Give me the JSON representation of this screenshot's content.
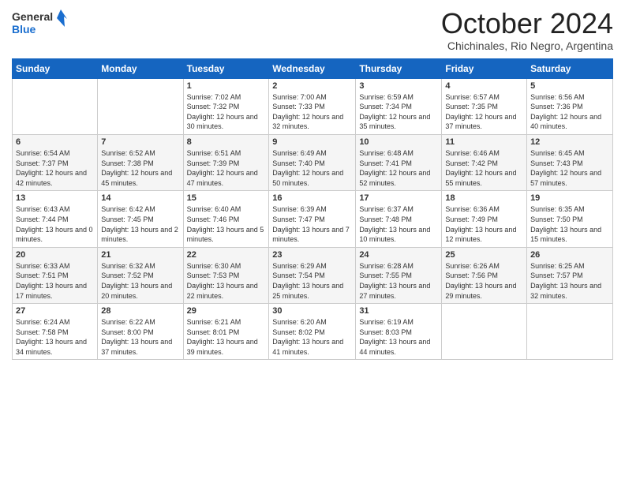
{
  "logo": {
    "general": "General",
    "blue": "Blue"
  },
  "header": {
    "month": "October 2024",
    "location": "Chichinales, Rio Negro, Argentina"
  },
  "weekdays": [
    "Sunday",
    "Monday",
    "Tuesday",
    "Wednesday",
    "Thursday",
    "Friday",
    "Saturday"
  ],
  "weeks": [
    [
      {
        "day": "",
        "info": ""
      },
      {
        "day": "",
        "info": ""
      },
      {
        "day": "1",
        "info": "Sunrise: 7:02 AM\nSunset: 7:32 PM\nDaylight: 12 hours and 30 minutes."
      },
      {
        "day": "2",
        "info": "Sunrise: 7:00 AM\nSunset: 7:33 PM\nDaylight: 12 hours and 32 minutes."
      },
      {
        "day": "3",
        "info": "Sunrise: 6:59 AM\nSunset: 7:34 PM\nDaylight: 12 hours and 35 minutes."
      },
      {
        "day": "4",
        "info": "Sunrise: 6:57 AM\nSunset: 7:35 PM\nDaylight: 12 hours and 37 minutes."
      },
      {
        "day": "5",
        "info": "Sunrise: 6:56 AM\nSunset: 7:36 PM\nDaylight: 12 hours and 40 minutes."
      }
    ],
    [
      {
        "day": "6",
        "info": "Sunrise: 6:54 AM\nSunset: 7:37 PM\nDaylight: 12 hours and 42 minutes."
      },
      {
        "day": "7",
        "info": "Sunrise: 6:52 AM\nSunset: 7:38 PM\nDaylight: 12 hours and 45 minutes."
      },
      {
        "day": "8",
        "info": "Sunrise: 6:51 AM\nSunset: 7:39 PM\nDaylight: 12 hours and 47 minutes."
      },
      {
        "day": "9",
        "info": "Sunrise: 6:49 AM\nSunset: 7:40 PM\nDaylight: 12 hours and 50 minutes."
      },
      {
        "day": "10",
        "info": "Sunrise: 6:48 AM\nSunset: 7:41 PM\nDaylight: 12 hours and 52 minutes."
      },
      {
        "day": "11",
        "info": "Sunrise: 6:46 AM\nSunset: 7:42 PM\nDaylight: 12 hours and 55 minutes."
      },
      {
        "day": "12",
        "info": "Sunrise: 6:45 AM\nSunset: 7:43 PM\nDaylight: 12 hours and 57 minutes."
      }
    ],
    [
      {
        "day": "13",
        "info": "Sunrise: 6:43 AM\nSunset: 7:44 PM\nDaylight: 13 hours and 0 minutes."
      },
      {
        "day": "14",
        "info": "Sunrise: 6:42 AM\nSunset: 7:45 PM\nDaylight: 13 hours and 2 minutes."
      },
      {
        "day": "15",
        "info": "Sunrise: 6:40 AM\nSunset: 7:46 PM\nDaylight: 13 hours and 5 minutes."
      },
      {
        "day": "16",
        "info": "Sunrise: 6:39 AM\nSunset: 7:47 PM\nDaylight: 13 hours and 7 minutes."
      },
      {
        "day": "17",
        "info": "Sunrise: 6:37 AM\nSunset: 7:48 PM\nDaylight: 13 hours and 10 minutes."
      },
      {
        "day": "18",
        "info": "Sunrise: 6:36 AM\nSunset: 7:49 PM\nDaylight: 13 hours and 12 minutes."
      },
      {
        "day": "19",
        "info": "Sunrise: 6:35 AM\nSunset: 7:50 PM\nDaylight: 13 hours and 15 minutes."
      }
    ],
    [
      {
        "day": "20",
        "info": "Sunrise: 6:33 AM\nSunset: 7:51 PM\nDaylight: 13 hours and 17 minutes."
      },
      {
        "day": "21",
        "info": "Sunrise: 6:32 AM\nSunset: 7:52 PM\nDaylight: 13 hours and 20 minutes."
      },
      {
        "day": "22",
        "info": "Sunrise: 6:30 AM\nSunset: 7:53 PM\nDaylight: 13 hours and 22 minutes."
      },
      {
        "day": "23",
        "info": "Sunrise: 6:29 AM\nSunset: 7:54 PM\nDaylight: 13 hours and 25 minutes."
      },
      {
        "day": "24",
        "info": "Sunrise: 6:28 AM\nSunset: 7:55 PM\nDaylight: 13 hours and 27 minutes."
      },
      {
        "day": "25",
        "info": "Sunrise: 6:26 AM\nSunset: 7:56 PM\nDaylight: 13 hours and 29 minutes."
      },
      {
        "day": "26",
        "info": "Sunrise: 6:25 AM\nSunset: 7:57 PM\nDaylight: 13 hours and 32 minutes."
      }
    ],
    [
      {
        "day": "27",
        "info": "Sunrise: 6:24 AM\nSunset: 7:58 PM\nDaylight: 13 hours and 34 minutes."
      },
      {
        "day": "28",
        "info": "Sunrise: 6:22 AM\nSunset: 8:00 PM\nDaylight: 13 hours and 37 minutes."
      },
      {
        "day": "29",
        "info": "Sunrise: 6:21 AM\nSunset: 8:01 PM\nDaylight: 13 hours and 39 minutes."
      },
      {
        "day": "30",
        "info": "Sunrise: 6:20 AM\nSunset: 8:02 PM\nDaylight: 13 hours and 41 minutes."
      },
      {
        "day": "31",
        "info": "Sunrise: 6:19 AM\nSunset: 8:03 PM\nDaylight: 13 hours and 44 minutes."
      },
      {
        "day": "",
        "info": ""
      },
      {
        "day": "",
        "info": ""
      }
    ]
  ]
}
